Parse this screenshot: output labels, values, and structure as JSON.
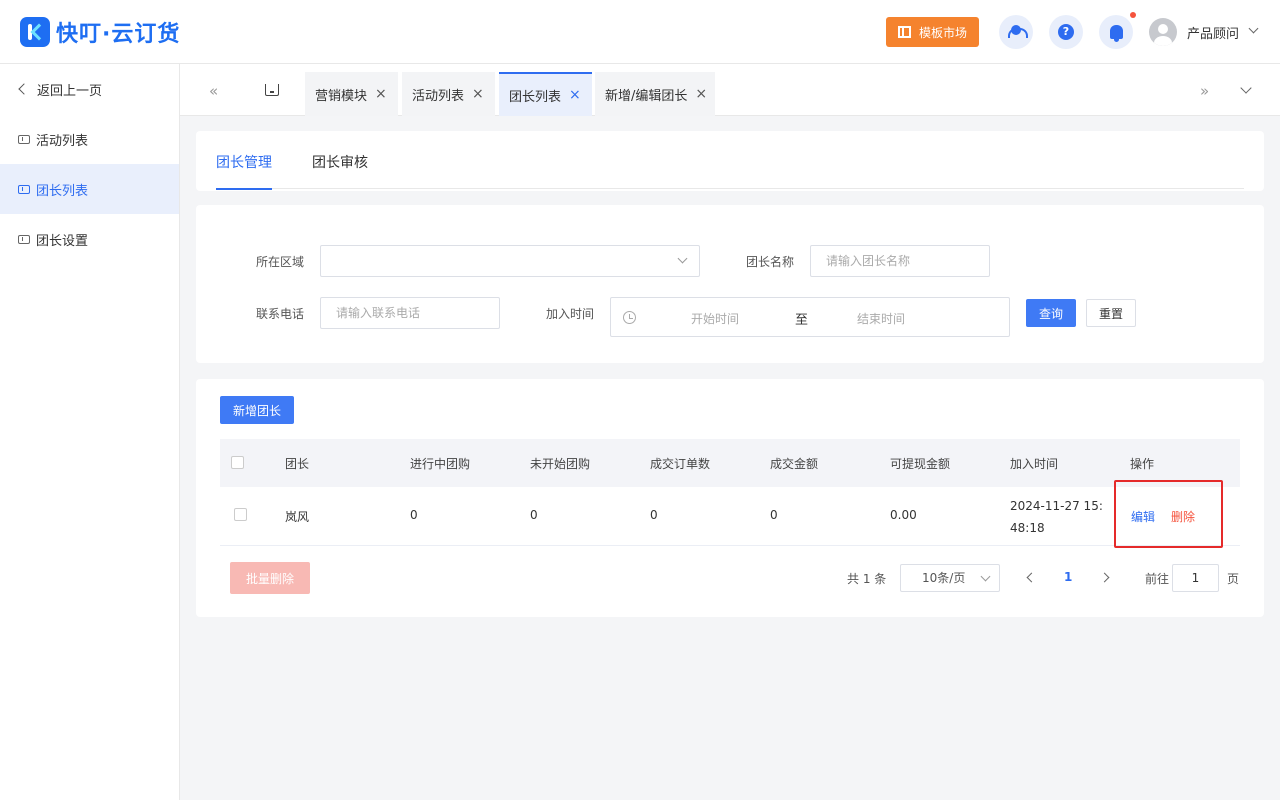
{
  "header": {
    "logo_text": "快叮·云订货",
    "template_market": "模板市场",
    "user_name": "产品顾问"
  },
  "sidebar": {
    "back": "返回上一页",
    "items": [
      {
        "label": "活动列表"
      },
      {
        "label": "团长列表"
      },
      {
        "label": "团长设置"
      }
    ],
    "active_index": 1
  },
  "tabs": {
    "items": [
      {
        "label": "营销模块",
        "close": "×"
      },
      {
        "label": "活动列表",
        "close": "×"
      },
      {
        "label": "团长列表",
        "close": "×"
      },
      {
        "label": "新增/编辑团长",
        "close": "×"
      }
    ],
    "scroll_left": "«",
    "scroll_right": "»"
  },
  "sub_tabs": {
    "items": [
      {
        "label": "团长管理"
      },
      {
        "label": "团长审核"
      }
    ]
  },
  "filter": {
    "region_label": "所在区域",
    "region_value": "",
    "name_label": "团长名称",
    "name_placeholder": "请输入团长名称",
    "phone_label": "联系电话",
    "phone_placeholder": "请输入联系电话",
    "join_time_label": "加入时间",
    "start_placeholder": "开始时间",
    "range_separator": "至",
    "end_placeholder": "结束时间",
    "query_button": "查询",
    "reset_button": "重置"
  },
  "list": {
    "add_button": "新增团长",
    "columns": [
      "团长",
      "进行中团购",
      "未开始团购",
      "成交订单数",
      "成交金额",
      "可提现金额",
      "加入时间",
      "操作"
    ],
    "rows": [
      {
        "leader": "岚风",
        "ongoing": "0",
        "not_started": "0",
        "orders": "0",
        "amount": "0",
        "withdrawable": "0.00",
        "join_time": "2024-11-27 15:48:18",
        "edit": "编辑",
        "delete": "删除"
      }
    ],
    "batch_delete": "批量删除"
  },
  "pagination": {
    "total": "共 1 条",
    "page_size": "10条/页",
    "current_page": "1",
    "goto_label": "前往",
    "goto_value": "1",
    "page_suffix": "页"
  }
}
